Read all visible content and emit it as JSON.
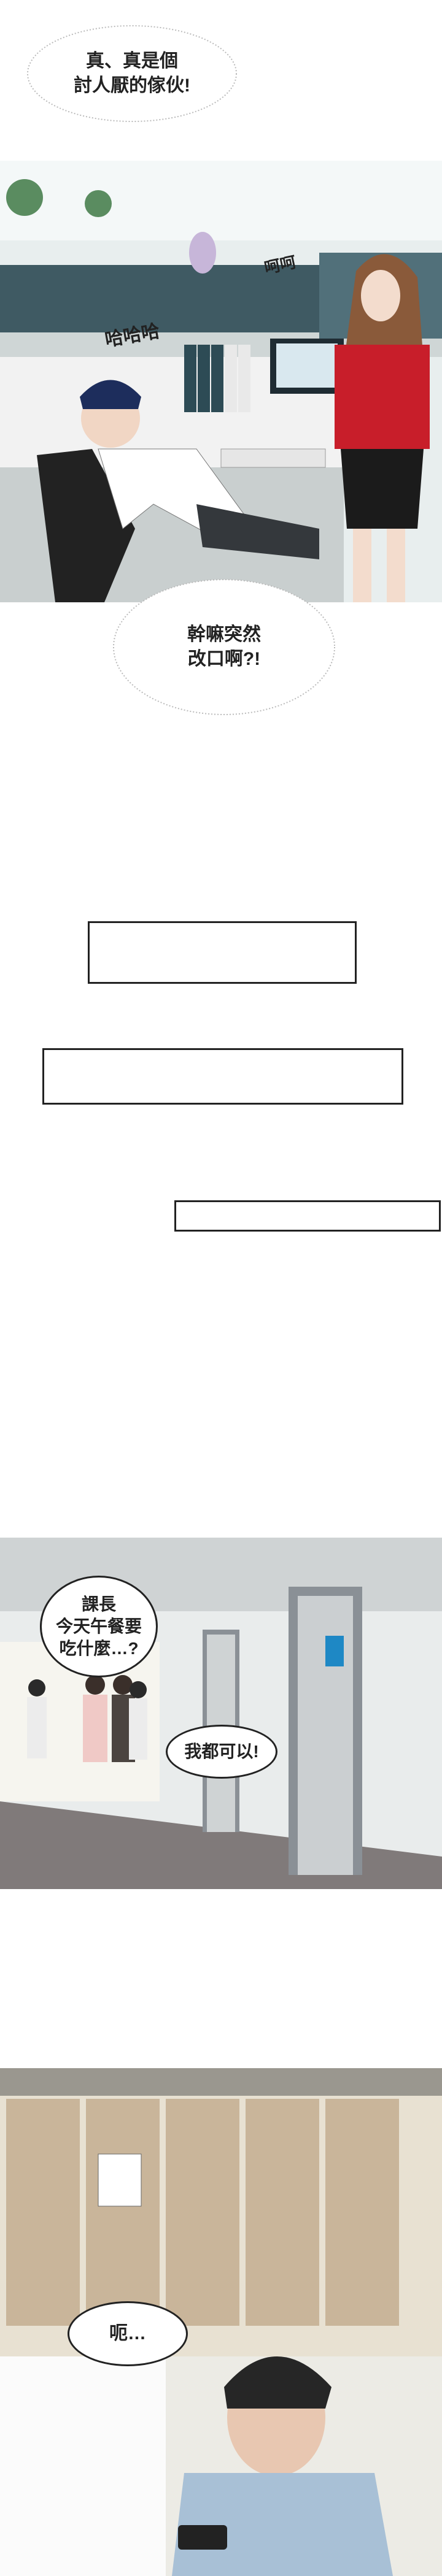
{
  "panels": {
    "office": {
      "bubble_top": "真、真是個\n討人厭的傢伙!",
      "sfx_laugh": "哈哈哈",
      "sfx_woman": "呵呵"
    },
    "bubble_change": "幹嘛突然\n改口啊?!",
    "hallway": {
      "bubble_lunch": "課長\n今天午餐要\n吃什麼…?",
      "bubble_any": "我都可以!"
    },
    "restroom": {
      "bubble_uh": "呃…"
    }
  }
}
